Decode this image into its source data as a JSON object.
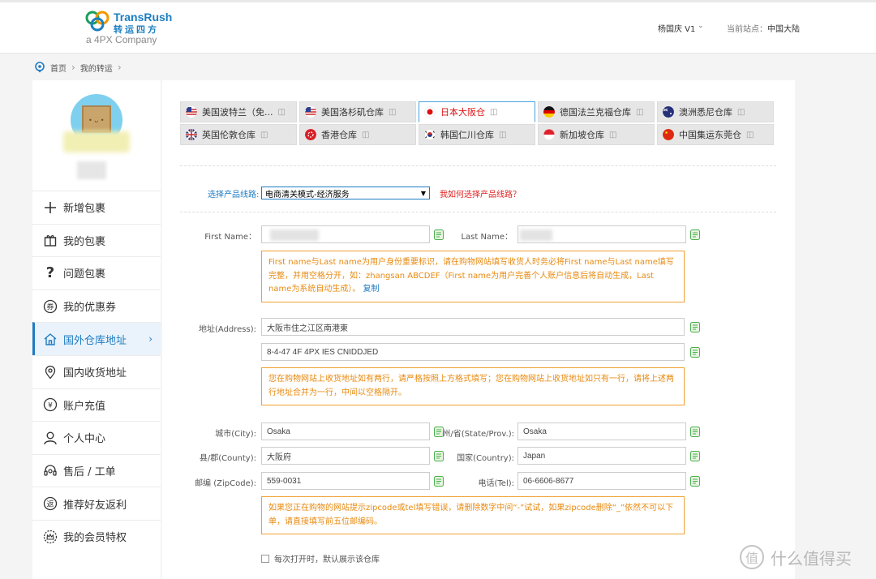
{
  "header": {
    "logo": {
      "brand_en": "TransRush",
      "brand_cn": "转运四方",
      "company": "a 4PX Company"
    },
    "user_name": "杨国庆 V1",
    "site_label": "当前站点：",
    "site_value": "中国大陆"
  },
  "breadcrumb": {
    "home": "首页",
    "current": "我的转运"
  },
  "sidebar": {
    "items": [
      {
        "label": "新增包裹",
        "icon": "plus-icon"
      },
      {
        "label": "我的包裹",
        "icon": "gift-icon"
      },
      {
        "label": "问题包裹",
        "icon": "question-icon"
      },
      {
        "label": "我的优惠券",
        "icon": "coupon-icon"
      },
      {
        "label": "国外仓库地址",
        "icon": "home-icon",
        "active": true
      },
      {
        "label": "国内收货地址",
        "icon": "location-pin-icon"
      },
      {
        "label": "账户充值",
        "icon": "yen-icon"
      },
      {
        "label": "个人中心",
        "icon": "user-icon"
      },
      {
        "label": "售后 / 工单",
        "icon": "headset-icon"
      },
      {
        "label": "推荐好友返利",
        "icon": "rebate-icon"
      },
      {
        "label": "我的会员特权",
        "icon": "crown-icon"
      }
    ]
  },
  "tabs": [
    {
      "label": "美国波特兰（免...",
      "flag": "us-flag-icon"
    },
    {
      "label": "美国洛杉矶仓库",
      "flag": "us-flag-icon"
    },
    {
      "label": "日本大阪仓",
      "flag": "jp-flag-icon",
      "active": true
    },
    {
      "label": "德国法兰克福仓库",
      "flag": "de-flag-icon"
    },
    {
      "label": "澳洲悉尼仓库",
      "flag": "au-flag-icon"
    },
    {
      "label": "英国伦敦仓库",
      "flag": "uk-flag-icon"
    },
    {
      "label": "香港仓库",
      "flag": "hk-flag-icon"
    },
    {
      "label": "韩国仁川仓库",
      "flag": "kr-flag-icon"
    },
    {
      "label": "新加坡仓库",
      "flag": "sg-flag-icon"
    },
    {
      "label": "中国集运东莞仓",
      "flag": "cn-flag-icon"
    }
  ],
  "product": {
    "label": "选择产品线路:",
    "selected": "电商清关模式-经济服务",
    "help_link": "我如何选择产品线路？"
  },
  "form": {
    "first_name_label": "First Name：",
    "last_name_label": "Last Name：",
    "name_notice": "First name与Last name为用户身份重要标识，请在购物网站填写收货人时务必将First name与Last name填写完整，并用空格分开，如：zhangsan ABCDEF（First name为用户完善个人账户信息后将自动生成，Last name为系统自动生成）。",
    "name_notice_link": "复制",
    "address_label": "地址(Address):",
    "address_line1": "大阪市住之江区南港東",
    "address_line2": "8-4-47 4F 4PX IES CNIDDJED",
    "address_notice": "您在购物网站上收货地址如有两行，请严格按照上方格式填写；您在购物网站上收货地址如只有一行，请将上述两行地址合并为一行，中间以空格隔开。",
    "city_label": "城市(City):",
    "city_value": "Osaka",
    "state_label": "州/省(State/Prov.):",
    "state_value": "Osaka",
    "county_label": "县/郡(County):",
    "county_value": "大阪府",
    "country_label": "国家(Country):",
    "country_value": "Japan",
    "zip_label": "邮编 (ZipCode):",
    "zip_value": "559-0031",
    "tel_label": "电话(Tel):",
    "tel_value": "06-6606-8677",
    "zip_notice": "如果您正在购物的网站提示zipcode或tel填写错误，请删除数字中间“-”试试，如果zipcode删除“_”依然不可以下单，请直接填写前五位邮编码。",
    "default_checkbox": "每次打开时，默认展示该仓库"
  },
  "watermark": {
    "text": "什么值得买",
    "icon": "smzdm-logo-icon"
  },
  "colors": {
    "accent": "#1d7bc2",
    "notice_border": "#f0a030",
    "notice_text": "#e88a10",
    "error_red": "#e02020"
  }
}
